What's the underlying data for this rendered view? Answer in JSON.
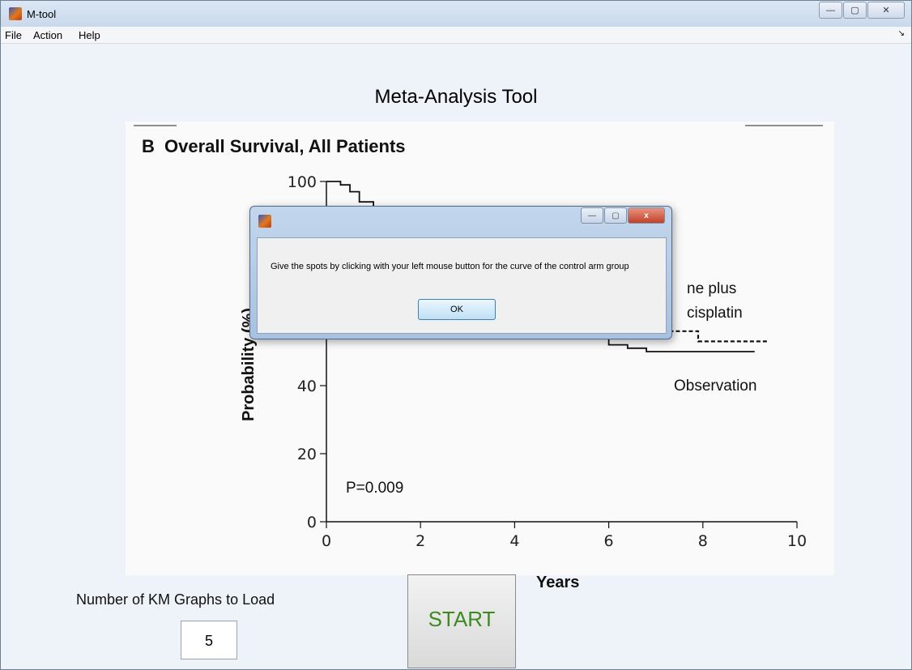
{
  "window": {
    "title": "M-tool",
    "controls": {
      "minimize": "—",
      "maximize": "▢",
      "close": "✕"
    }
  },
  "menu": {
    "items": [
      "File",
      "Action",
      "Help"
    ],
    "overflow_arrow": "↘"
  },
  "app_title": "Meta-Analysis Tool",
  "km_figure": {
    "panel_letter": "B",
    "title": "Overall Survival, All Patients",
    "ylabel": "Probability (%)",
    "xlabel": "Years",
    "p_value": "P=0.009",
    "arm_label_line1": "ne plus",
    "arm_label_line2": "cisplatin",
    "control_label": "Observation"
  },
  "chart_data": {
    "type": "line",
    "title": "Overall Survival, All Patients",
    "xlabel": "Years",
    "ylabel": "Probability (%)",
    "xlim": [
      0,
      10
    ],
    "ylim": [
      0,
      100
    ],
    "x_ticks": [
      0,
      2,
      4,
      6,
      8,
      10
    ],
    "y_ticks": [
      0,
      20,
      40,
      100
    ],
    "series": [
      {
        "name": "Observation",
        "style": "solid",
        "x": [
          0,
          0.3,
          0.5,
          0.7,
          1.0,
          1.3,
          1.6,
          2.0,
          2.5,
          3.0,
          3.5,
          4.0,
          4.5,
          5.0,
          5.4,
          5.7,
          6.0,
          6.4,
          6.8,
          7.5,
          8.0,
          8.6,
          9.1
        ],
        "y": [
          100,
          99,
          97,
          94,
          90,
          84,
          78,
          74,
          70,
          67,
          64,
          62,
          60,
          57,
          56,
          54,
          52,
          51,
          50,
          50,
          50,
          50,
          50
        ]
      },
      {
        "name": "ne plus cisplatin",
        "style": "dashed",
        "x": [
          6.6,
          7.0,
          7.8,
          7.9,
          9.4
        ],
        "y": [
          56,
          56,
          56,
          53,
          53
        ]
      }
    ],
    "annotations": [
      "P=0.009"
    ]
  },
  "dialog": {
    "message": "Give the spots by clicking with your left mouse button for the curve of the control arm group",
    "ok_label": "OK",
    "controls": {
      "minimize": "—",
      "maximize": "▢",
      "close": "x"
    }
  },
  "controls": {
    "num_graphs_label": "Number of  KM Graphs to Load",
    "num_graphs_value": "5",
    "start_label": "START"
  },
  "colors": {
    "start_text": "#3d8b1f",
    "dialog_close": "#c2412a",
    "titlebar": "#c9d9ec"
  }
}
